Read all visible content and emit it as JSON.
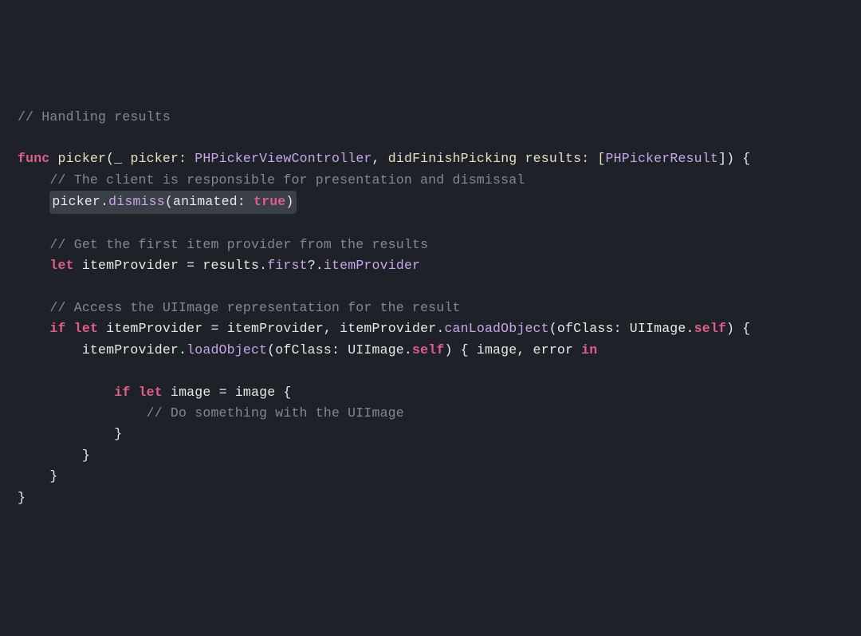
{
  "code": {
    "l1_comment": "// Handling results",
    "l3_func": "func",
    "l3_name": "picker",
    "l3_p": "(",
    "l3_u": "_",
    "l3_arg1": " picker: ",
    "l3_ty1": "PHPickerViewController",
    "l3_c1": ", ",
    "l3_arg2": "didFinishPicking",
    "l3_arg2b": " results: [",
    "l3_ty2": "PHPickerResult",
    "l3_close": "]) {",
    "l4_comment": "    // The client is responsible for presentation and dismissal",
    "l5_pre": "    ",
    "l5_obj": "picker.",
    "l5_m": "dismiss",
    "l5_p": "(animated: ",
    "l5_true": "true",
    "l5_cp": ")",
    "l7_comment": "    // Get the first item provider from the results",
    "l8_let": "let",
    "l8_txt": " itemProvider = results.",
    "l8_first": "first",
    "l8_q": "?.",
    "l8_ip": "itemProvider",
    "l10_comment": "    // Access the UIImage representation for the result",
    "l11_if": "if",
    "l11_let": "let",
    "l11_a": " itemProvider = itemProvider, itemProvider.",
    "l11_m": "canLoadObject",
    "l11_b": "(ofClass: UIImage.",
    "l11_self": "self",
    "l11_c": ") {",
    "l12_a": "        itemProvider.",
    "l12_m": "loadObject",
    "l12_b": "(ofClass: UIImage.",
    "l12_self": "self",
    "l12_c": ") { image, error ",
    "l12_in": "in",
    "l14_if": "if",
    "l14_let": "let",
    "l14_txt": " image = image {",
    "l15_comment": "                // Do something with the UIImage",
    "l16": "            }",
    "l17": "        }",
    "l18": "    }",
    "l19": "}"
  }
}
